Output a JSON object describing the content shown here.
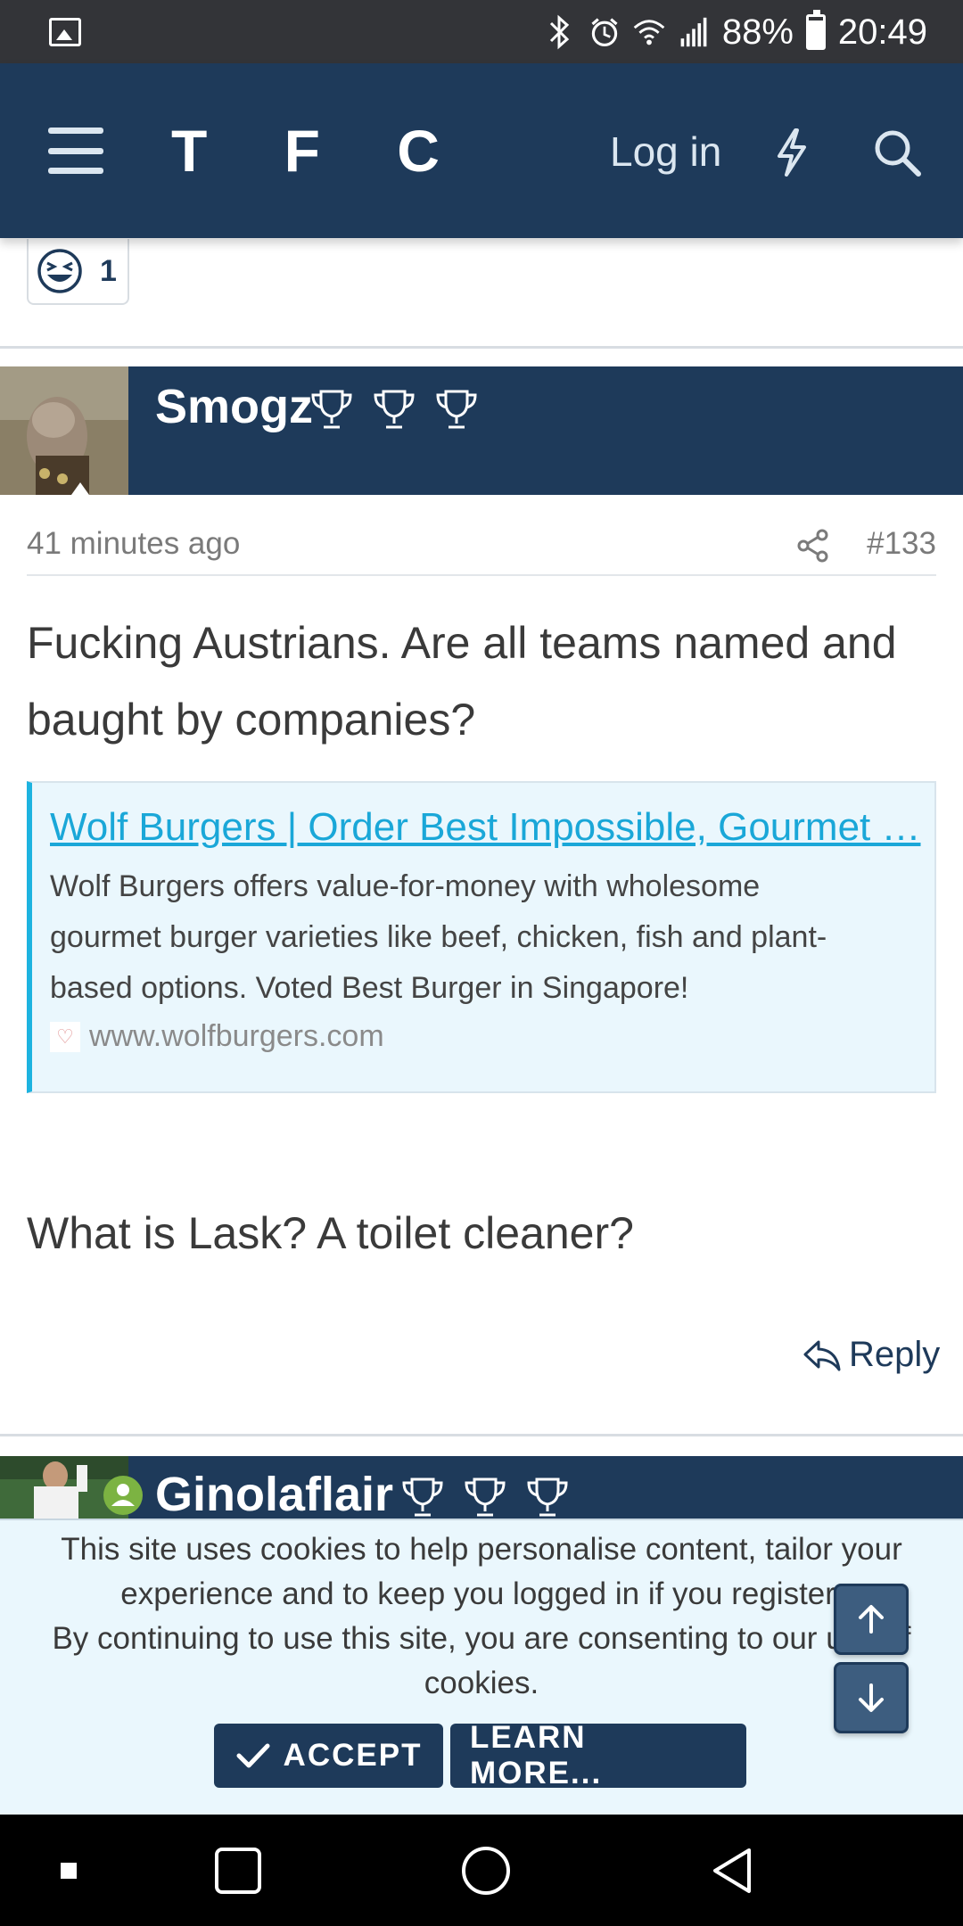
{
  "status_bar": {
    "battery": "88%",
    "time": "20:49",
    "icons": [
      "gallery-icon",
      "bluetooth-icon",
      "alarm-icon",
      "wifi-icon",
      "signal-icon",
      "battery-icon"
    ]
  },
  "header": {
    "logo": "T F C",
    "login_label": "Log in",
    "icons": [
      "menu-icon",
      "lightning-icon",
      "search-icon"
    ]
  },
  "previous_post": {
    "reaction_count": "1",
    "reaction_icon": "laughing-face-icon"
  },
  "post": {
    "author": "Smogz",
    "trophy_count": 3,
    "time_ago": "41 minutes ago",
    "post_number": "#133",
    "body_line1": "Fucking Austrians. Are all teams named and",
    "body_line2": "baught by companies?",
    "link_card": {
      "title": "Wolf Burgers | Order Best Impossible, Gourmet …",
      "description_line1": "Wolf Burgers offers value-for-money with wholesome",
      "description_line2": "gourmet burger varieties like beef, chicken, fish and plant-",
      "description_line3": "based options. Voted Best Burger in Singapore!",
      "site": "www.wolfburgers.com"
    },
    "body_after": "What is Lask? A toilet cleaner?",
    "reply_label": "Reply"
  },
  "next_post": {
    "author": "Ginolaflair",
    "trophy_count": 3,
    "online_indicator": true
  },
  "cookie_banner": {
    "line1": "This site uses cookies to help personalise content, tailor your",
    "line2": "experience and to keep you logged in if you register.",
    "line3": "By continuing to use this site, you are consenting to our use of",
    "line4": "cookies.",
    "accept_label": "ACCEPT",
    "learn_more_label": "LEARN MORE..."
  },
  "colors": {
    "brand_navy": "#1e3a5a",
    "link_blue": "#1aa7d8",
    "card_bg": "#eaf7fd",
    "online_green": "#7cb342"
  }
}
